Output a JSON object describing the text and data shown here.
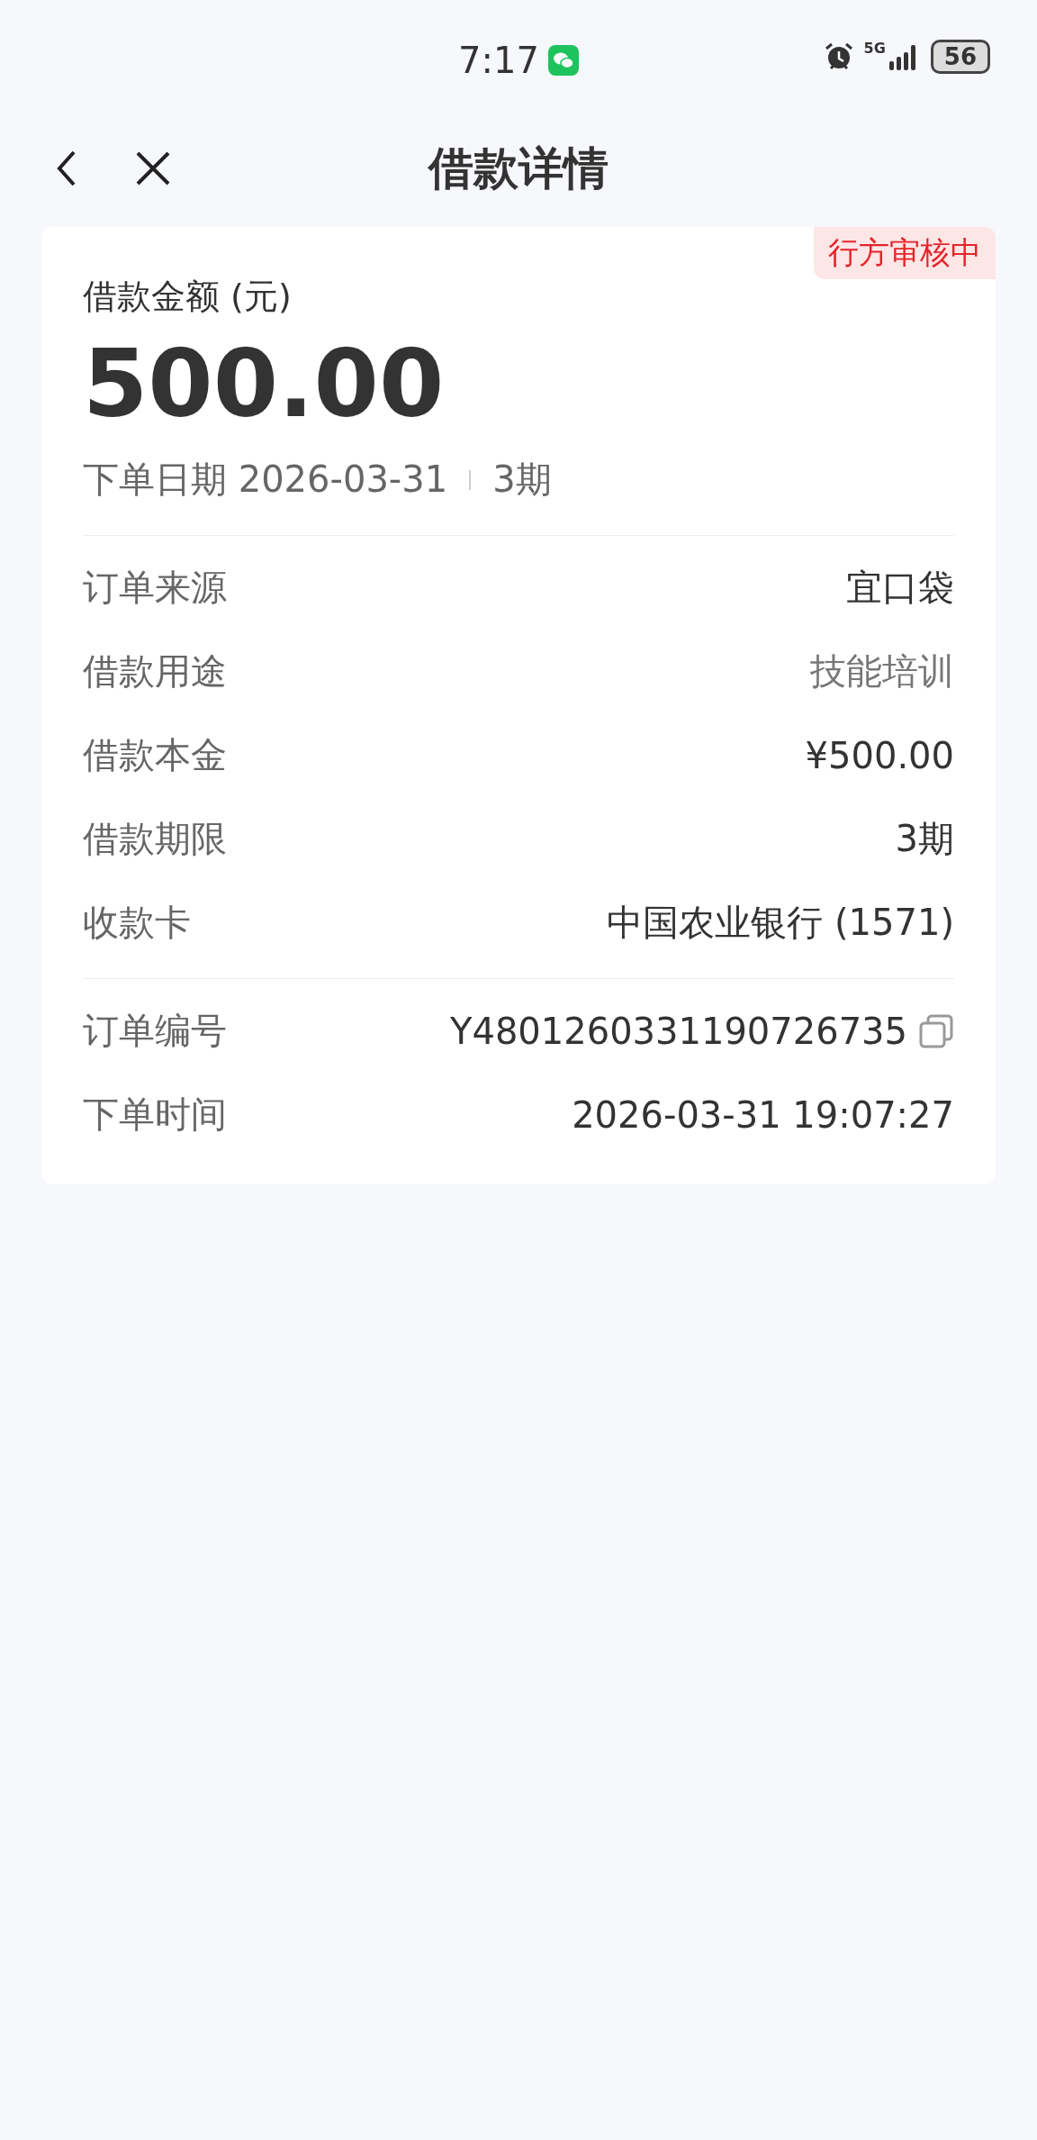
{
  "status_bar": {
    "time": "7:17",
    "network": "5G",
    "battery": "56"
  },
  "nav": {
    "title": "借款详情"
  },
  "card": {
    "status_badge": "行方审核中",
    "amount_label": "借款金额 (元)",
    "amount": "500.00",
    "date_label": "下单日期 2026-03-31",
    "term": "3期",
    "details": [
      {
        "label": "订单来源",
        "value": "宜口袋",
        "muted": false
      },
      {
        "label": "借款用途",
        "value": "技能培训",
        "muted": true
      },
      {
        "label": "借款本金",
        "value": "¥500.00",
        "muted": false
      },
      {
        "label": "借款期限",
        "value": "3期",
        "muted": false
      },
      {
        "label": "收款卡",
        "value": "中国农业银行 (1571)",
        "muted": false
      }
    ],
    "order_info": [
      {
        "label": "订单编号",
        "value": "Y4801260331190726735",
        "kind": "copy"
      },
      {
        "label": "下单时间",
        "value": "2026-03-31 19:07:27",
        "kind": "text"
      }
    ]
  }
}
